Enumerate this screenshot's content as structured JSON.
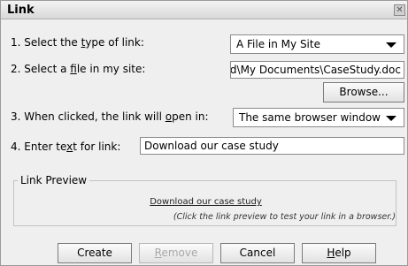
{
  "dialog": {
    "title": "Link",
    "close_glyph": "✕"
  },
  "form": {
    "type_label_pre": "1. Select the ",
    "type_label_u": "t",
    "type_label_post": "ype of link:",
    "type_value": "A File in My Site",
    "file_label_pre": "2. Select a ",
    "file_label_u": "f",
    "file_label_post": "ile in my site:",
    "file_value": "d\\My Documents\\CaseStudy.doc",
    "browse_label": "Browse...",
    "open_label_pre": "3. When clicked, the link will ",
    "open_label_u": "o",
    "open_label_post": "pen in:",
    "open_value": "The same browser window",
    "text_label_pre": "4. Enter te",
    "text_label_u": "x",
    "text_label_post": "t for link:",
    "text_value": "Download our case study"
  },
  "preview": {
    "legend": "Link Preview",
    "link_text": "Download our case study",
    "hint": "(Click the link preview to test your link in a browser.)"
  },
  "buttons": {
    "create": "Create",
    "remove_u": "R",
    "remove_rest": "emove",
    "cancel": "Cancel",
    "help_u": "H",
    "help_rest": "elp"
  }
}
